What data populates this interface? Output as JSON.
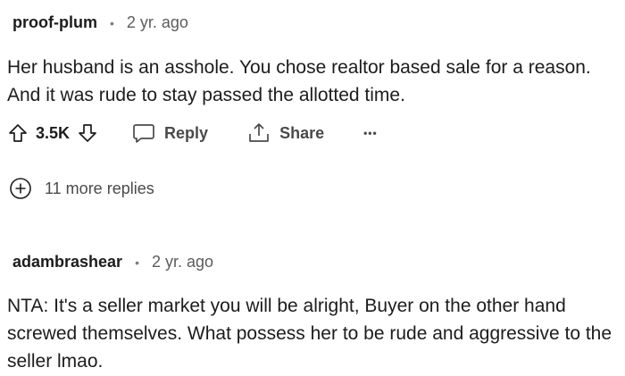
{
  "comments": [
    {
      "author": "proof-plum",
      "separator": "•",
      "age": "2 yr. ago",
      "body": "Her husband is an asshole. You chose realtor based sale for a reason. And it was rude to stay passed the allotted time.",
      "score": "3.5K",
      "reply_label": "Reply",
      "share_label": "Share",
      "more_label": "•••",
      "more_replies": "11 more replies"
    },
    {
      "author": "adambrashear",
      "separator": "•",
      "age": "2 yr. ago",
      "body": "NTA: It's a seller market you will be alright, Buyer on the other hand screwed themselves. What possess her to be rude and aggressive to the seller lmao."
    }
  ],
  "icons": {
    "upvote": "arrow-up-outline-icon",
    "downvote": "arrow-down-outline-icon",
    "reply": "speech-bubble-icon",
    "share": "share-upload-icon",
    "more": "ellipsis-icon",
    "expand": "plus-circle-icon"
  }
}
